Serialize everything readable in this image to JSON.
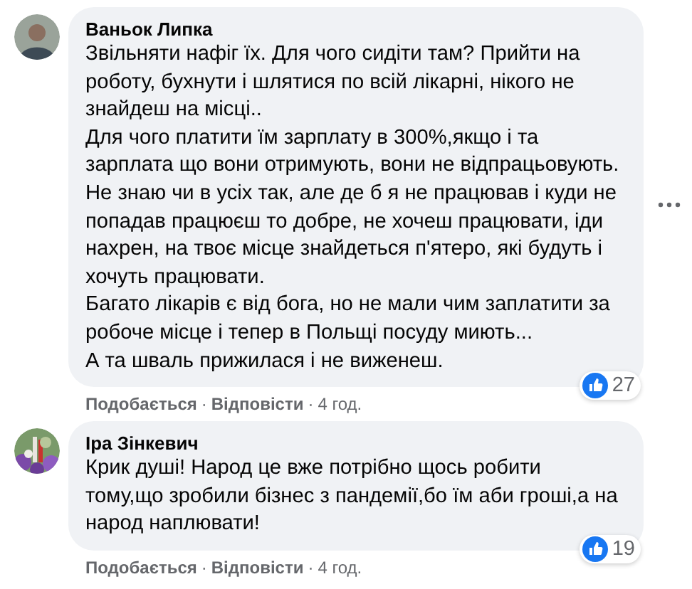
{
  "comments": [
    {
      "author": "Ваньок Липка",
      "avatar": {
        "kind": "person"
      },
      "has_menu": true,
      "paragraphs": [
        "Звільняти нафіг їх. Для чого сидіти там? Прийти на роботу, бухнути і шлятися по всій лікарні, нікого не знайдеш на місці..",
        "Для чого платити їм зарплату в 300%,якщо і та зарплата що вони отримують, вони не відпрацьовують.",
        "Не знаю чи в усіх так, але де б я не працював і куди не попадав працюєш то добре, не хочеш працювати, іди нахрен, на твоє місце знайдеться п'ятеро, які будуть і хочуть працювати.",
        "Багато лікарів є від бога, но не мали чим заплатити за робоче місце і тепер в Польщі посуду миють...",
        "А та шваль прижилася і не виженеш."
      ],
      "reaction_count": "27",
      "actions": [
        {
          "kind": "link",
          "text": "Подобається"
        },
        {
          "kind": "separator",
          "text": "·"
        },
        {
          "kind": "link",
          "text": "Відповісти"
        },
        {
          "kind": "separator",
          "text": "·"
        },
        {
          "kind": "time",
          "text": "4 год."
        }
      ]
    },
    {
      "author": "Іра Зінкевич",
      "avatar": {
        "kind": "picture"
      },
      "has_menu": false,
      "paragraphs": [
        "Крик душі! Народ це вже потрібно щось робити тому,що зробили бізнес з пандемії,бо їм аби гроші,а на народ наплювати!"
      ],
      "reaction_count": "19",
      "actions": [
        {
          "kind": "link",
          "text": "Подобається"
        },
        {
          "kind": "separator",
          "text": "·"
        },
        {
          "kind": "link",
          "text": "Відповісти"
        },
        {
          "kind": "separator",
          "text": "·"
        },
        {
          "kind": "time",
          "text": "4 год."
        }
      ]
    }
  ]
}
